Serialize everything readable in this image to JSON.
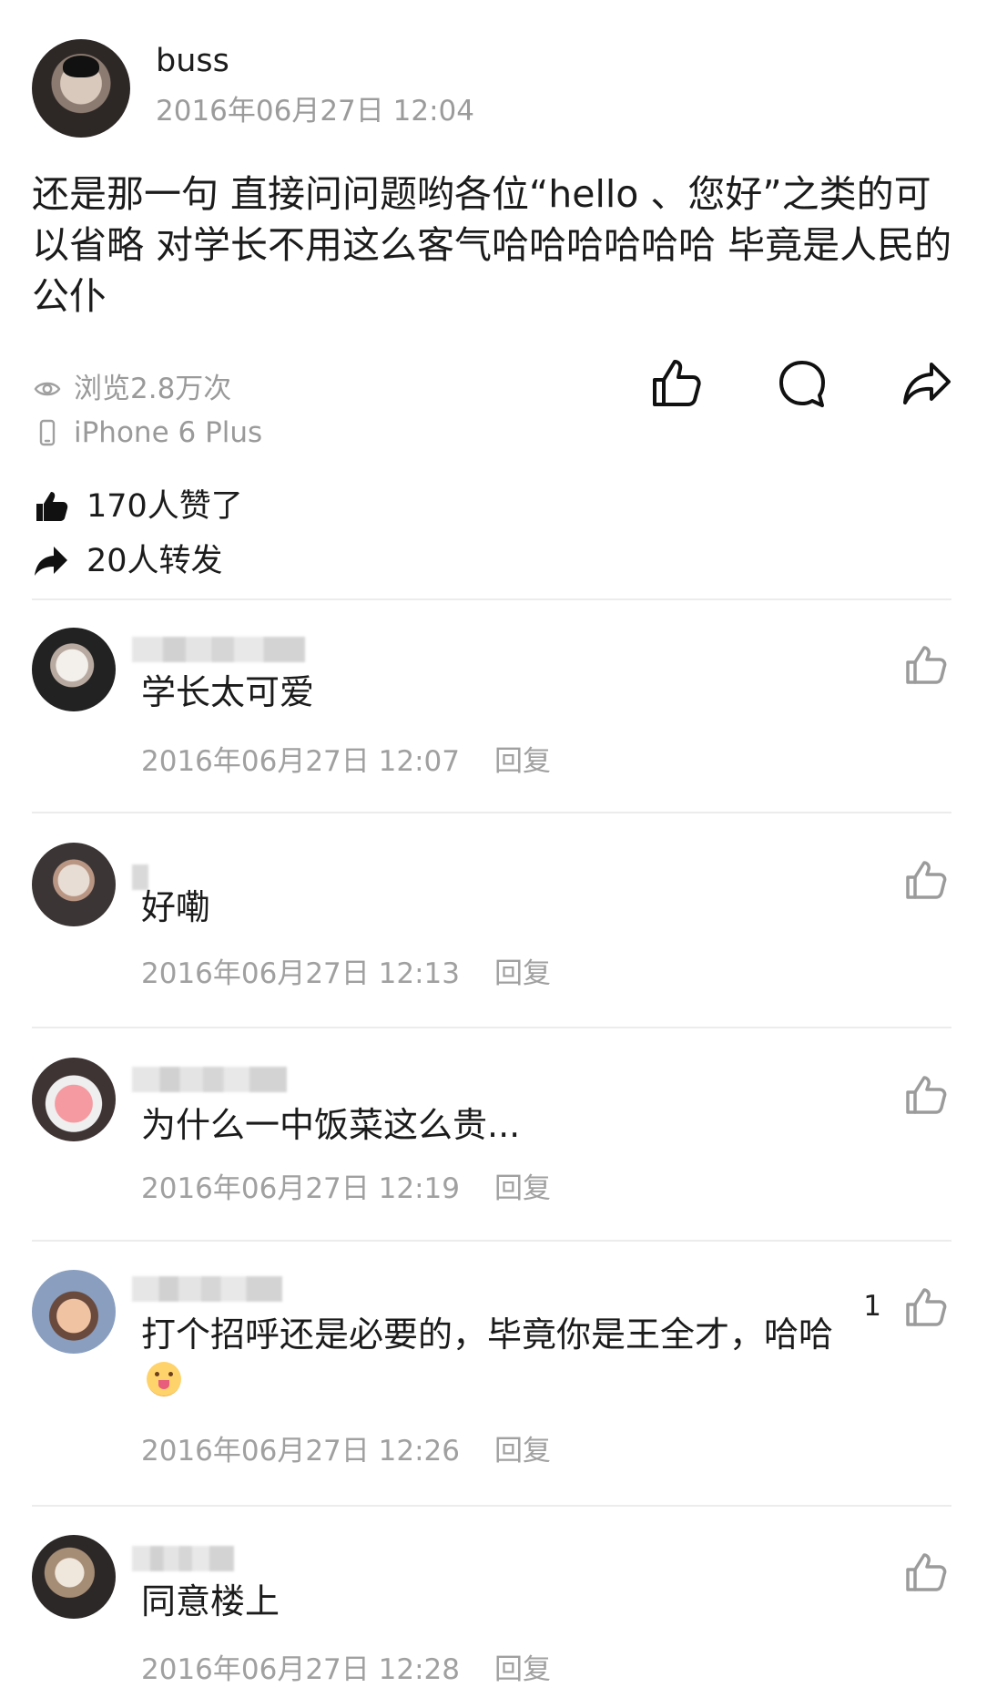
{
  "post": {
    "author": "buss",
    "time": "2016年06月27日 12:04",
    "text": "还是那一句 直接问问题哟各位“hello 、您好”之类的可以省略 对学长不用这么客气哈哈哈哈哈哈 毕竟是人民的公仆",
    "views": "浏览2.8万次",
    "device": "iPhone 6 Plus",
    "likes": "170人赞了",
    "reposts": "20人转发"
  },
  "icons": {
    "views": "eye-icon",
    "device": "phone-icon",
    "like_action": "thumb-up-icon",
    "comment_action": "speech-bubble-icon",
    "share_action": "share-arrow-icon",
    "likes_stat": "thumb-up-filled-icon",
    "reposts_stat": "share-filled-icon"
  },
  "comments": [
    {
      "text": "学长太可爱",
      "time": "2016年06月27日 12:07",
      "reply": "回复",
      "likes": ""
    },
    {
      "text": "好嘞",
      "time": "2016年06月27日 12:13",
      "reply": "回复",
      "likes": ""
    },
    {
      "text": "为什么一中饭菜这么贵...",
      "time": "2016年06月27日 12:19",
      "reply": "回复",
      "likes": ""
    },
    {
      "text": "打个招呼还是必要的，毕竟你是王全才，哈哈",
      "time": "2016年06月27日 12:26",
      "reply": "回复",
      "likes": "1"
    },
    {
      "text": "同意楼上",
      "time": "2016年06月27日 12:28",
      "reply": "回复",
      "likes": ""
    }
  ],
  "colors": {
    "background": "#ffffff",
    "primary_text": "#1b1b1b",
    "secondary_text": "#9b9b9b",
    "divider": "#ececec"
  }
}
